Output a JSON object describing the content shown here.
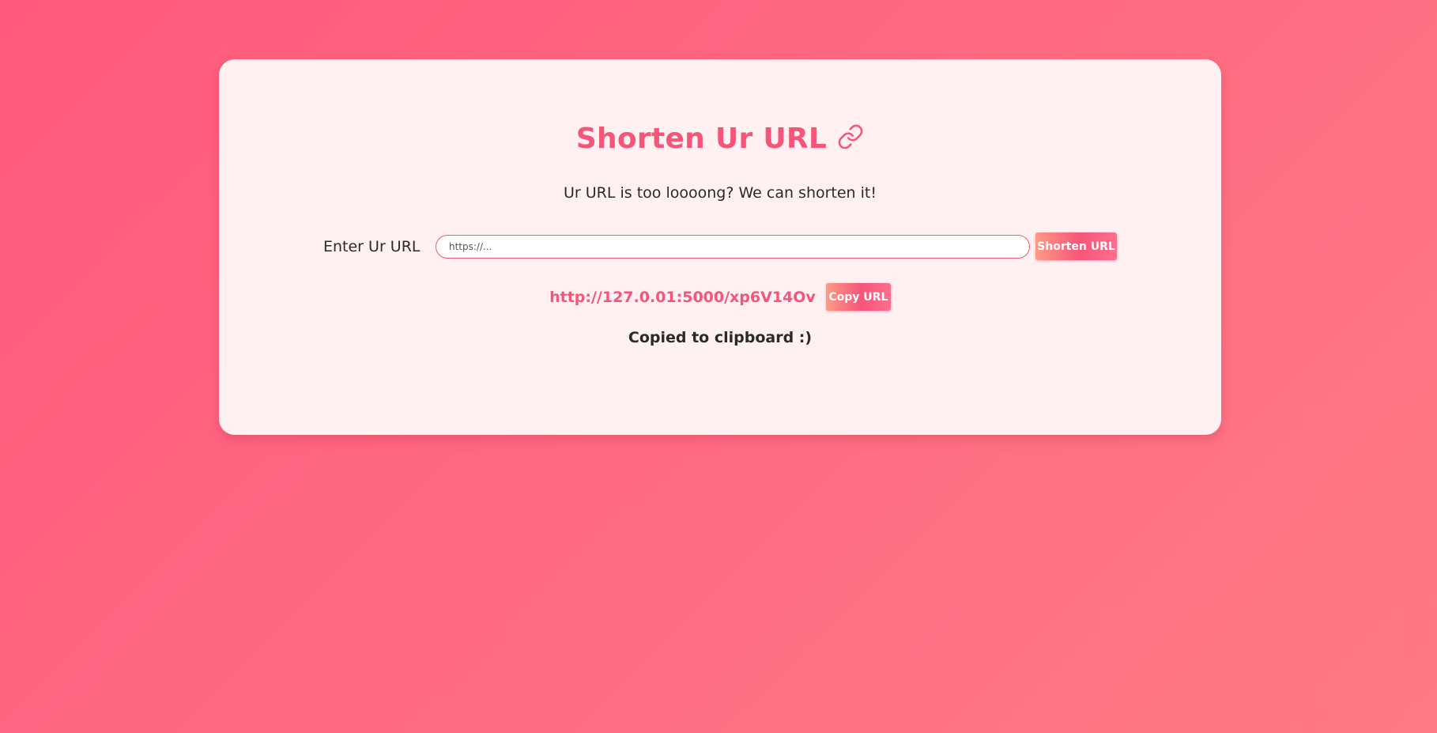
{
  "header": {
    "title": "Shorten Ur URL",
    "title_icon": "link-icon",
    "subtitle": "Ur URL is too loooong? We can shorten it!"
  },
  "form": {
    "label": "Enter Ur URL",
    "input_placeholder": "https://...",
    "input_value": "",
    "submit_label": "Shorten URL"
  },
  "result": {
    "short_url": "http://127.0.01:5000/xp6V14Ov",
    "copy_label": "Copy URL",
    "status_message": "Copied to clipboard :)"
  },
  "colors": {
    "accent": "#f6557a",
    "background": "#ff6a82",
    "card": "#fff0f2",
    "text": "#2a2a2a"
  }
}
